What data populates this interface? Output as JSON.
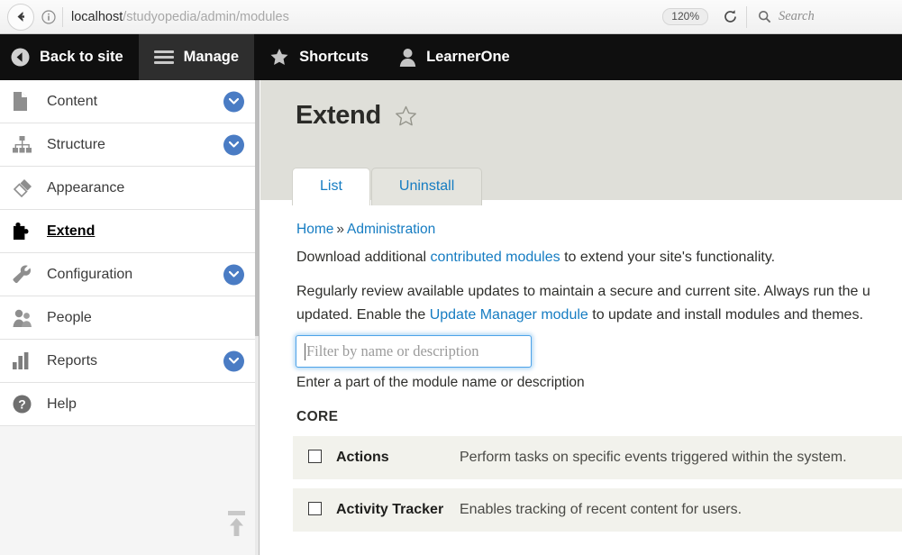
{
  "browser": {
    "back_icon": "back-arrow-icon",
    "info_icon": "site-info-icon",
    "url_host": "localhost",
    "url_path": "/studyopedia/admin/modules",
    "zoom_level": "120%",
    "reload_icon": "reload-icon",
    "search_icon": "search-icon",
    "search_placeholder": "Search"
  },
  "toolbar": {
    "items": [
      {
        "label": "Back to site",
        "icon": "circle-back-arrow-icon",
        "active": false
      },
      {
        "label": "Manage",
        "icon": "hamburger-menu-icon",
        "active": true
      },
      {
        "label": "Shortcuts",
        "icon": "star-icon",
        "active": false
      },
      {
        "label": "LearnerOne",
        "icon": "user-account-icon",
        "active": false
      }
    ]
  },
  "sidebar": {
    "items": [
      {
        "label": "Content",
        "icon": "document-icon",
        "expandable": true,
        "active": false
      },
      {
        "label": "Structure",
        "icon": "sitemap-icon",
        "expandable": true,
        "active": false
      },
      {
        "label": "Appearance",
        "icon": "paintbrush-icon",
        "expandable": false,
        "active": false
      },
      {
        "label": "Extend",
        "icon": "puzzle-piece-icon",
        "expandable": false,
        "active": true
      },
      {
        "label": "Configuration",
        "icon": "wrench-icon",
        "expandable": true,
        "active": false
      },
      {
        "label": "People",
        "icon": "people-icon",
        "expandable": false,
        "active": false
      },
      {
        "label": "Reports",
        "icon": "bar-chart-icon",
        "expandable": true,
        "active": false
      },
      {
        "label": "Help",
        "icon": "question-mark-icon",
        "expandable": false,
        "active": false
      }
    ],
    "collapse_icon": "collapse-up-arrow-icon"
  },
  "page": {
    "title": "Extend",
    "shortcut_star_icon": "star-outline-icon",
    "tabs": [
      {
        "label": "List",
        "active": true
      },
      {
        "label": "Uninstall",
        "active": false
      }
    ],
    "breadcrumb": {
      "home": "Home",
      "separator": "»",
      "current": "Administration"
    },
    "intro_line1": {
      "before": "Download additional ",
      "link": "contributed modules",
      "after": " to extend your site's functionality."
    },
    "intro_line2": {
      "before": "Regularly review available updates to maintain a secure and current site. Always run the u",
      "middle_before": "updated. Enable the ",
      "link": "Update Manager module",
      "after": " to update and install modules and themes."
    },
    "filter": {
      "placeholder": "Filter by name or description",
      "value": "",
      "description": "Enter a part of the module name or description"
    },
    "section_header": "CORE",
    "modules": [
      {
        "name": "Actions",
        "description": "Perform tasks on specific events triggered within the system.",
        "checked": false
      },
      {
        "name": "Activity Tracker",
        "description": "Enables tracking of recent content for users.",
        "checked": false
      }
    ]
  },
  "colors": {
    "toolbar_bg": "#0f0f0f",
    "link_blue": "#157cc2",
    "chevron_blue": "#4a7cc4",
    "page_header_bg": "#dfdfd9",
    "row_bg": "#f2f2ec",
    "focus_blue": "#4ea3e8"
  }
}
